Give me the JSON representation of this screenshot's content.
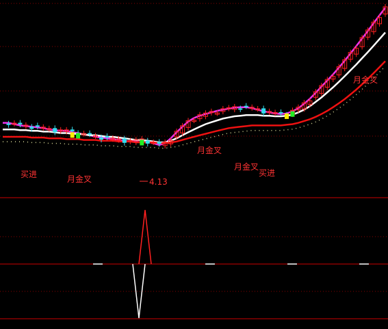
{
  "colors": {
    "background": "#000000",
    "grid": "#8b0000",
    "divider": "#cc0000",
    "candle_up": "#ff2020",
    "candle_down": "#33ddee",
    "candle_flat": "#ffffff",
    "ma_white": "#ffffff",
    "ma_magenta": "#ee33ee",
    "ma_red": "#ee1111",
    "ma_dotted": "#dddd99",
    "signal_label": "#ff3333",
    "price_label": "#ff3333",
    "osc_up": "#ff2020",
    "osc_down": "#ffffff",
    "bar_yellow": "#ffee00",
    "bar_green": "#22ee22"
  },
  "annotations": {
    "buy1": "买进",
    "golden1": "月金叉",
    "low_price": "4.13",
    "golden2": "月金叉",
    "golden3": "月金叉",
    "buy2": "买进",
    "golden4": "月金叉"
  },
  "chart_data": [
    {
      "type": "candlestick",
      "title": "",
      "series": [
        {
          "name": "",
          "values": [
            11.0,
            11.0,
            10.8,
            10.6,
            10.5,
            10.4,
            10.3,
            10.2,
            10.0,
            9.9,
            9.8,
            9.8,
            9.6,
            9.5,
            9.3,
            9.2,
            9.0,
            8.9,
            8.8,
            8.7,
            8.6,
            8.5,
            8.4,
            8.5,
            8.6,
            8.4,
            8.2,
            8.0,
            8.2,
            8.8,
            9.6,
            10.4,
            11.2,
            11.8,
            12.2,
            12.5,
            12.8,
            13.1,
            13.3,
            13.5,
            13.7,
            13.8,
            13.8,
            13.6,
            13.3,
            13.0,
            12.8,
            12.6,
            12.5,
            12.6,
            13.0,
            13.6,
            14.5,
            15.6,
            17.0,
            18.6,
            20.3,
            22.2,
            24.4,
            27.0,
            30.0,
            33.4,
            37.2,
            41.5,
            46.5,
            52.0,
            58.0
          ]
        },
        {
          "name": "",
          "values": [
            10.0,
            10.0,
            10.0,
            9.9,
            9.9,
            9.8,
            9.8,
            9.7,
            9.7,
            9.6,
            9.5,
            9.5,
            9.4,
            9.4,
            9.3,
            9.2,
            9.2,
            9.1,
            9.0,
            9.0,
            8.9,
            8.8,
            8.7,
            8.6,
            8.6,
            8.5,
            8.4,
            8.3,
            8.3,
            8.5,
            8.8,
            9.2,
            9.6,
            10.0,
            10.4,
            10.8,
            11.1,
            11.4,
            11.7,
            11.9,
            12.1,
            12.2,
            12.3,
            12.3,
            12.3,
            12.2,
            12.2,
            12.1,
            12.1,
            12.2,
            12.4,
            12.8,
            13.3,
            14.0,
            14.9,
            15.9,
            17.1,
            18.4,
            19.9,
            21.6,
            23.5,
            25.6,
            28.0,
            30.6,
            33.6,
            36.9,
            40.6
          ]
        },
        {
          "name": "",
          "values": [
            9.0,
            9.0,
            9.0,
            9.0,
            9.0,
            8.9,
            8.9,
            8.9,
            8.8,
            8.8,
            8.8,
            8.7,
            8.7,
            8.7,
            8.6,
            8.6,
            8.6,
            8.5,
            8.5,
            8.5,
            8.4,
            8.4,
            8.4,
            8.3,
            8.3,
            8.3,
            8.3,
            8.2,
            8.2,
            8.3,
            8.4,
            8.6,
            8.8,
            9.0,
            9.2,
            9.4,
            9.6,
            9.8,
            10.0,
            10.2,
            10.3,
            10.4,
            10.5,
            10.6,
            10.6,
            10.6,
            10.6,
            10.6,
            10.6,
            10.7,
            10.8,
            11.0,
            11.3,
            11.6,
            12.0,
            12.5,
            13.1,
            13.8,
            14.6,
            15.5,
            16.6,
            17.8,
            19.2,
            20.8,
            22.6,
            24.6,
            26.8
          ]
        }
      ],
      "oscillator": {
        "x": [
          0,
          11,
          12,
          13,
          14,
          15,
          16,
          17,
          35,
          48,
          50,
          56,
          59,
          65
        ],
        "values": [
          0,
          0,
          8,
          -12,
          0,
          0,
          0,
          0,
          0,
          0,
          0,
          0,
          0,
          0
        ]
      },
      "xlabel": "",
      "ylabel": ""
    }
  ]
}
